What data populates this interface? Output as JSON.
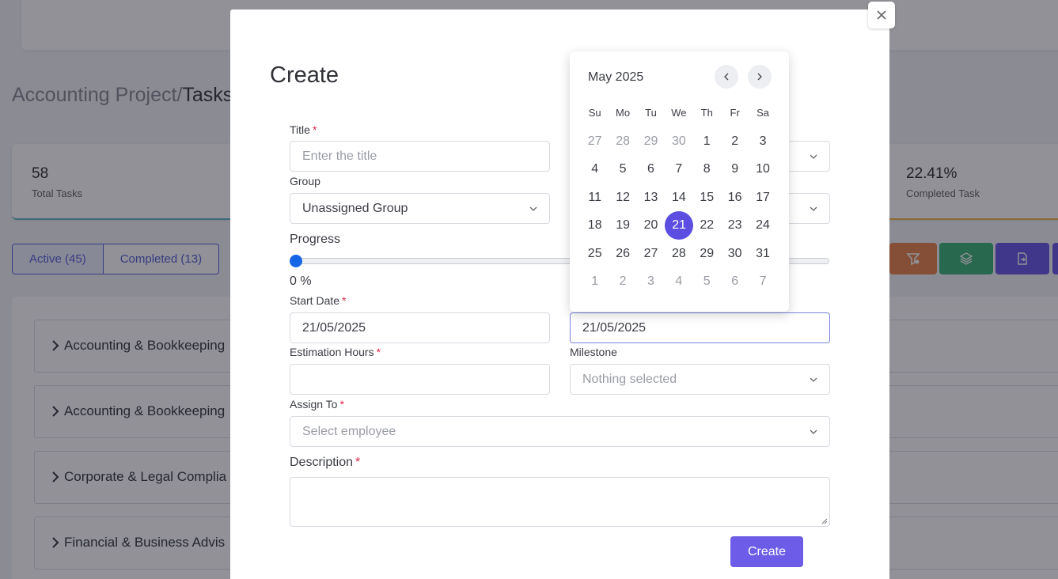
{
  "breadcrumb": {
    "project": "Accounting Project/",
    "current": "Tasks"
  },
  "stats": [
    {
      "value": "58",
      "label": "Total Tasks"
    },
    {
      "value": "22.41%",
      "label": "Completed Task"
    }
  ],
  "tabs": [
    {
      "label": "Active (45)"
    },
    {
      "label": "Completed (13)"
    }
  ],
  "toolbar_colors": {
    "filter": "#e8874f",
    "layers": "#3fb47a",
    "export": "#6c5ce7"
  },
  "groups": [
    {
      "title": "Accounting & Bookkeeping"
    },
    {
      "title": "Accounting & Bookkeeping"
    },
    {
      "title": "Corporate & Legal Complia"
    },
    {
      "title": "Financial & Business Advis"
    }
  ],
  "modal": {
    "title": "Create",
    "close_icon": "close-icon",
    "fields": {
      "title": {
        "label": "Title",
        "required": "*",
        "placeholder": "Enter the title"
      },
      "group": {
        "label": "Group",
        "value": "Unassigned Group"
      },
      "progress": {
        "label": "Progress",
        "value": "0 %"
      },
      "start_date": {
        "label": "Start Date",
        "required": "*",
        "value": "21/05/2025"
      },
      "end_date": {
        "value": "21/05/2025"
      },
      "estimation_hours": {
        "label": "Estimation Hours",
        "required": "*"
      },
      "milestone": {
        "label": "Milestone",
        "value": "Nothing selected"
      },
      "assign_to": {
        "label": "Assign To",
        "required": "*",
        "value": "Select employee"
      },
      "description": {
        "label": "Description",
        "required": "*"
      }
    },
    "create_label": "Create"
  },
  "calendar": {
    "month": "May 2025",
    "weekdays": [
      "Su",
      "Mo",
      "Tu",
      "We",
      "Th",
      "Fr",
      "Sa"
    ],
    "weeks": [
      [
        "27",
        "28",
        "29",
        "30",
        "1",
        "2",
        "3"
      ],
      [
        "4",
        "5",
        "6",
        "7",
        "8",
        "9",
        "10"
      ],
      [
        "11",
        "12",
        "13",
        "14",
        "15",
        "16",
        "17"
      ],
      [
        "18",
        "19",
        "20",
        "21",
        "22",
        "23",
        "24"
      ],
      [
        "25",
        "26",
        "27",
        "28",
        "29",
        "30",
        "31"
      ],
      [
        "1",
        "2",
        "3",
        "4",
        "5",
        "6",
        "7"
      ]
    ],
    "selected": "21",
    "accent": "#5b4ee0"
  }
}
